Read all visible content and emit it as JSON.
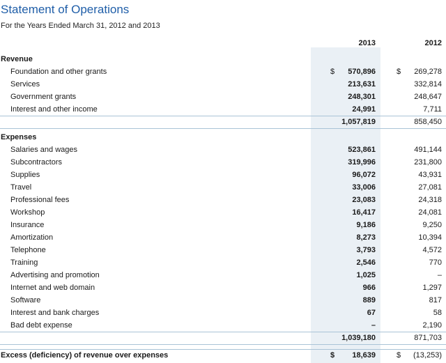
{
  "title": "Statement of Operations",
  "subtitle": "For the Years Ended March 31, 2012 and 2013",
  "columns": {
    "y2013": "2013",
    "y2012": "2012"
  },
  "revenue": {
    "heading": "Revenue",
    "rows": [
      {
        "label": "Foundation and other grants",
        "v2013": "570,896",
        "v2012": "269,278",
        "dollar": "$"
      },
      {
        "label": "Services",
        "v2013": "213,631",
        "v2012": "332,814"
      },
      {
        "label": "Government grants",
        "v2013": "248,301",
        "v2012": "248,647"
      },
      {
        "label": "Interest and other income",
        "v2013": "24,991",
        "v2012": "7,711"
      }
    ],
    "total": {
      "v2013": "1,057,819",
      "v2012": "858,450"
    }
  },
  "expenses": {
    "heading": "Expenses",
    "rows": [
      {
        "label": "Salaries and wages",
        "v2013": "523,861",
        "v2012": "491,144"
      },
      {
        "label": "Subcontractors",
        "v2013": "319,996",
        "v2012": "231,800"
      },
      {
        "label": "Supplies",
        "v2013": "96,072",
        "v2012": "43,931"
      },
      {
        "label": "Travel",
        "v2013": "33,006",
        "v2012": "27,081"
      },
      {
        "label": "Professional fees",
        "v2013": "23,083",
        "v2012": "24,318"
      },
      {
        "label": "Workshop",
        "v2013": "16,417",
        "v2012": "24,081"
      },
      {
        "label": "Insurance",
        "v2013": "9,186",
        "v2012": "9,250"
      },
      {
        "label": "Amortization",
        "v2013": "8,273",
        "v2012": "10,394"
      },
      {
        "label": "Telephone",
        "v2013": "3,793",
        "v2012": "4,572"
      },
      {
        "label": "Training",
        "v2013": "2,546",
        "v2012": "770"
      },
      {
        "label": "Advertising and promotion",
        "v2013": "1,025",
        "v2012": "–"
      },
      {
        "label": "Internet and web domain",
        "v2013": "966",
        "v2012": "1,297"
      },
      {
        "label": "Software",
        "v2013": "889",
        "v2012": "817"
      },
      {
        "label": "Interest and bank charges",
        "v2013": "67",
        "v2012": "58"
      },
      {
        "label": "Bad debt expense",
        "v2013": "–",
        "v2012": "2,190"
      }
    ],
    "total": {
      "v2013": "1,039,180",
      "v2012": "871,703"
    }
  },
  "excess": {
    "label": "Excess (deficiency) of revenue over expenses",
    "dollar": "$",
    "v2013": "18,639",
    "v2012": "(13,253)"
  }
}
